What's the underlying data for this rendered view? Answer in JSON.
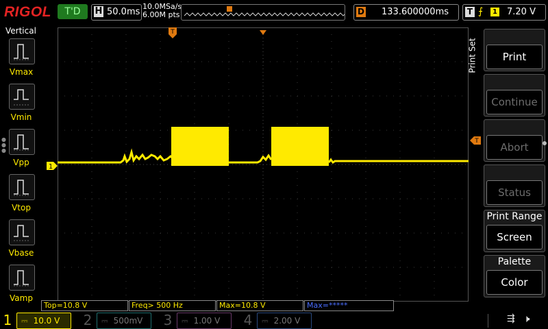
{
  "brand": "RIGOL",
  "run_state": "T'D",
  "timebase": {
    "key": "H",
    "value": "50.0ms"
  },
  "sample_rate": "10.0MSa/s",
  "memory_depth": "6.00M pts",
  "delay": {
    "key": "D",
    "value": "133.600000ms"
  },
  "trigger": {
    "key": "T",
    "source": "1",
    "level": "7.20 V"
  },
  "left_panel": {
    "title": "Vertical",
    "items": [
      {
        "label": "Vmax",
        "icon": "vmax-icon"
      },
      {
        "label": "Vmin",
        "icon": "vmin-icon"
      },
      {
        "label": "Vpp",
        "icon": "vpp-icon"
      },
      {
        "label": "Vtop",
        "icon": "vtop-icon"
      },
      {
        "label": "Vbase",
        "icon": "vbase-icon"
      },
      {
        "label": "Vamp",
        "icon": "vamp-icon"
      }
    ]
  },
  "menu": {
    "title": "Print Set",
    "items": [
      {
        "caption": "",
        "value": "Print",
        "enabled": true
      },
      {
        "caption": "",
        "value": "Continue",
        "enabled": false
      },
      {
        "caption": "",
        "value": "Abort",
        "enabled": false
      },
      {
        "caption": "",
        "value": "Status",
        "enabled": false
      },
      {
        "caption": "Print Range",
        "value": "Screen",
        "enabled": true
      },
      {
        "caption": "Palette",
        "value": "Color",
        "enabled": true
      }
    ]
  },
  "measurements": [
    {
      "text": "Top=10.8 V",
      "color": "#ffea00"
    },
    {
      "text": "Freq> 500 Hz",
      "color": "#ffea00"
    },
    {
      "text": "Max=10.8 V",
      "color": "#ffea00"
    },
    {
      "text": "Max=*****",
      "color": "#4a6dff"
    }
  ],
  "channels": [
    {
      "num": "1",
      "scale": "10.0 V",
      "color": "#ffea00",
      "active": true
    },
    {
      "num": "2",
      "scale": "500mV",
      "color": "#1f7070",
      "active": false
    },
    {
      "num": "3",
      "scale": "1.00 V",
      "color": "#6a3a6a",
      "active": false
    },
    {
      "num": "4",
      "scale": "2.00 V",
      "color": "#2a4a80",
      "active": false
    }
  ],
  "trace": {
    "color": "#ffea00",
    "ch1_marker": "1",
    "trigger_marker": "T"
  },
  "colors": {
    "accent": "#ffea00",
    "trigger": "#e07a10",
    "brand": "#e42323"
  }
}
